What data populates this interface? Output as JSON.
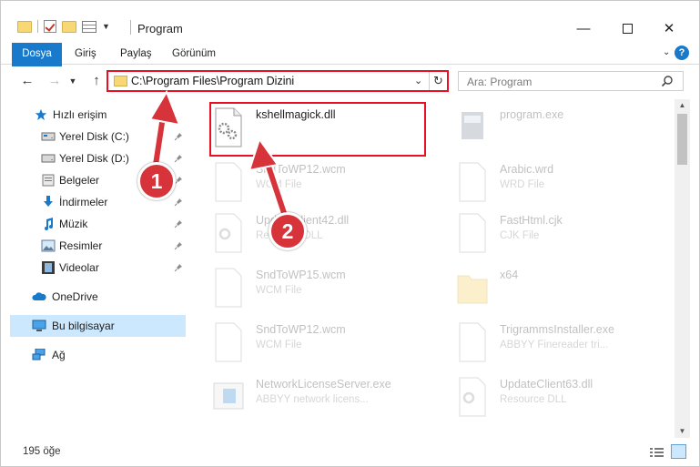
{
  "window": {
    "title": "Program",
    "controls": {
      "minimize": "—",
      "close": "✕"
    }
  },
  "ribbon": {
    "tabs": [
      "Dosya",
      "Giriş",
      "Paylaş",
      "Görünüm"
    ],
    "help": "?"
  },
  "navigation": {
    "address": "C:\\Program Files\\Program Dizini",
    "search_placeholder": "Ara: Program"
  },
  "sidebar": {
    "items": [
      {
        "label": "Hızlı erişim",
        "icon": "star-icon"
      },
      {
        "label": "Yerel Disk (C:)",
        "icon": "drive-icon",
        "pinned": true
      },
      {
        "label": "Yerel Disk (D:)",
        "icon": "drive-icon",
        "pinned": true
      },
      {
        "label": "Belgeler",
        "icon": "documents-icon",
        "pinned": true
      },
      {
        "label": "İndirmeler",
        "icon": "downloads-icon",
        "pinned": true
      },
      {
        "label": "Müzik",
        "icon": "music-icon",
        "pinned": true
      },
      {
        "label": "Resimler",
        "icon": "pictures-icon",
        "pinned": true
      },
      {
        "label": "Videolar",
        "icon": "videos-icon",
        "pinned": true
      },
      {
        "label": "OneDrive",
        "icon": "cloud-icon"
      },
      {
        "label": "Bu bilgisayar",
        "icon": "computer-icon",
        "selected": true
      },
      {
        "label": "Ağ",
        "icon": "network-icon"
      }
    ]
  },
  "files": [
    {
      "name": "kshellmagick.dll",
      "sub": "",
      "icon": "dll-file-icon",
      "highlighted": true
    },
    {
      "name": "program.exe",
      "sub": "",
      "icon": "exe-file-icon"
    },
    {
      "name": "SndToWP12.wcm",
      "sub": "WCM File",
      "icon": "blank-file-icon"
    },
    {
      "name": "Arabic.wrd",
      "sub": "WRD File",
      "icon": "blank-file-icon"
    },
    {
      "name": "UpdateClient42.dll",
      "sub": "Resource DLL",
      "icon": "dll-file-icon"
    },
    {
      "name": "FastHtml.cjk",
      "sub": "CJK File",
      "icon": "blank-file-icon"
    },
    {
      "name": "SndToWP15.wcm",
      "sub": "WCM File",
      "icon": "blank-file-icon"
    },
    {
      "name": "x64",
      "sub": "",
      "icon": "folder-icon"
    },
    {
      "name": "SndToWP12.wcm",
      "sub": "WCM File",
      "icon": "blank-file-icon"
    },
    {
      "name": "TrigrammsInstaller.exe",
      "sub": "ABBYY Finereader tri...",
      "icon": "blank-file-icon"
    },
    {
      "name": "NetworkLicenseServer.exe",
      "sub": "ABBYY network licens...",
      "icon": "app-file-icon"
    },
    {
      "name": "UpdateClient63.dll",
      "sub": "Resource DLL",
      "icon": "dll-file-icon"
    }
  ],
  "status": {
    "count": "195 öğe"
  },
  "annotations": {
    "step1": "1",
    "step2": "2"
  },
  "colors": {
    "accent": "#1979ca",
    "highlight": "#e81123",
    "badge": "#d7333a",
    "selected": "#cce8ff"
  }
}
